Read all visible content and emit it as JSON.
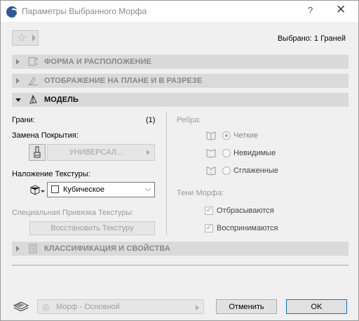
{
  "window": {
    "title": "Параметры Выбранного Морфа",
    "help": "?",
    "close": "✕"
  },
  "header": {
    "favorites_icon": "star-icon",
    "selected_info": "Выбрано: 1 Граней"
  },
  "sections": {
    "shape": "ФОРМА И РАСПОЛОЖЕНИЕ",
    "plan": "ОТОБРАЖЕНИЕ НА ПЛАНЕ И В РАЗРЕЗЕ",
    "model": "МОДЕЛЬ",
    "classification": "КЛАССИФИКАЦИЯ И СВОЙСТВА"
  },
  "model": {
    "faces_label": "Грани:",
    "faces_count": "(1)",
    "surface_override_label": "Замена Покрытия:",
    "surface_value": "УНИВЕРСАЛ...",
    "texture_mapping_label": "Наложение Текстуры:",
    "texture_mapping_value": "Кубическое",
    "special_mapping_label": "Специальная Привязка Текстуры:",
    "restore_texture_button": "Восстановить Текстуру",
    "edges_label": "Ребра:",
    "edges": [
      {
        "label": "Четкие",
        "checked": true
      },
      {
        "label": "Невидимые",
        "checked": false
      },
      {
        "label": "Сглаженные",
        "checked": false
      }
    ],
    "shadows_label": "Тени Морфа:",
    "shadows": [
      {
        "label": "Отбрасываются",
        "checked": true
      },
      {
        "label": "Воспринимаются",
        "checked": true
      }
    ]
  },
  "footer": {
    "layer_value": "Морф - Основной",
    "cancel": "Отменить",
    "ok": "OK"
  },
  "colors": {
    "section_bg": "#dadada",
    "ok_border": "#0078d7",
    "disabled_text": "#a0a0a0"
  }
}
